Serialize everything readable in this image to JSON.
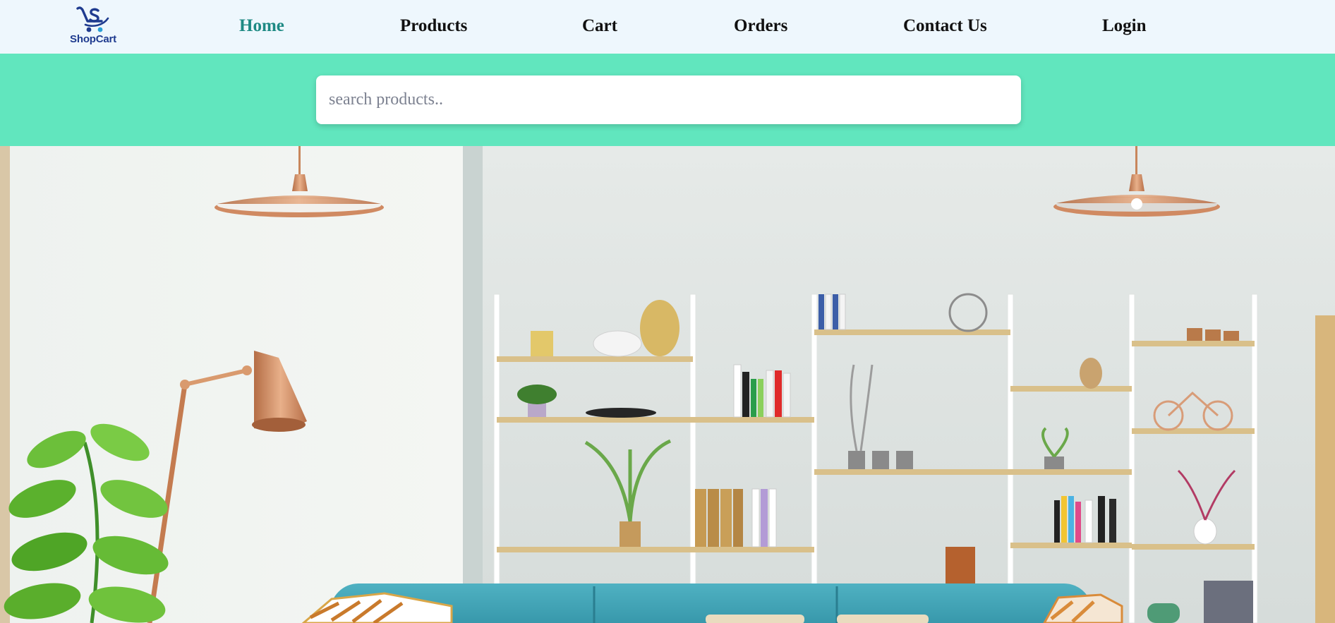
{
  "brand": {
    "name": "ShopCart",
    "logo_icon": "shopping-cart-s-icon",
    "logo_color": "#1f3b8f",
    "accent_dot_color": "#2a9fd6"
  },
  "nav": {
    "active_color": "#1e8a84",
    "items": [
      {
        "label": "Home",
        "active": true
      },
      {
        "label": "Products",
        "active": false
      },
      {
        "label": "Cart",
        "active": false
      },
      {
        "label": "Orders",
        "active": false
      },
      {
        "label": "Contact Us",
        "active": false
      },
      {
        "label": "Login",
        "active": false
      }
    ]
  },
  "search": {
    "placeholder": "search products..",
    "value": "",
    "band_color": "#61e6be"
  },
  "hero": {
    "image": "living-room-interior-banner"
  }
}
